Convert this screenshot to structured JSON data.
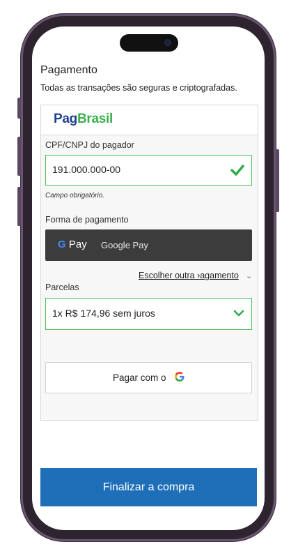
{
  "page": {
    "title": "Pagamento",
    "subtitle": "Todas as transações são seguras e criptografadas."
  },
  "brand": {
    "part1": "Pag",
    "part2": "Brasil"
  },
  "cpf": {
    "label": "CPF/CNPJ do pagador",
    "value": "191.000.000-00",
    "hint": "Campo obrigatório."
  },
  "payment_method": {
    "label": "Forma de pagamento",
    "gpay_logo_text": "Pay",
    "gpay_label": "Google Pay",
    "other_link": "Escolher outra ›agamento"
  },
  "installments": {
    "label": "Parcelas",
    "selected": "1x R$ 174,96 sem juros"
  },
  "google_pay_button": {
    "label": "Pagar com o"
  },
  "finish_button": {
    "label": "Finalizar a compra"
  },
  "colors": {
    "brand_blue": "#1d3f8f",
    "brand_green": "#3ab14a",
    "valid_green": "#4cbf5b",
    "finish_blue": "#1e6fb8"
  }
}
